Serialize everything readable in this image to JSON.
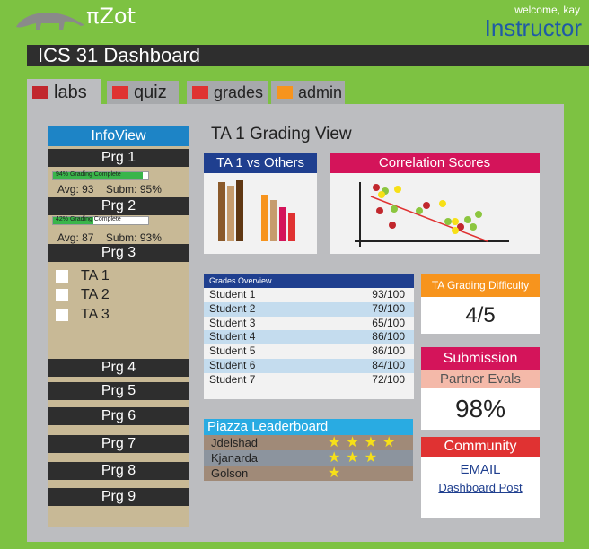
{
  "header": {
    "brand": "πZot",
    "welcome": "welcome, kay",
    "role": "Instructor",
    "title": "ICS 31 Dashboard"
  },
  "tabs": [
    {
      "label": "labs",
      "color": "#c1272d"
    },
    {
      "label": "quiz",
      "color": "#e03232"
    },
    {
      "label": "grades",
      "color": "#e03232"
    },
    {
      "label": "admin",
      "color": "#f7941d"
    }
  ],
  "sidebar": {
    "header": "InfoView",
    "programs": [
      {
        "label": "Prg 1",
        "progress": 0.94,
        "progress_label": "94% Grading Complete",
        "avg": "Avg: 93",
        "subm": "Subm: 95%"
      },
      {
        "label": "Prg 2",
        "progress": 0.42,
        "progress_label": "42% Grading Complete",
        "avg": "Avg: 87",
        "subm": "Subm: 93%"
      },
      {
        "label": "Prg 3"
      },
      {
        "label": "Prg 4"
      },
      {
        "label": "Prg 5"
      },
      {
        "label": "Prg 6"
      },
      {
        "label": "Prg 7"
      },
      {
        "label": "Prg 8"
      },
      {
        "label": "Prg 9"
      }
    ],
    "tas": [
      "TA 1",
      "TA 2",
      "TA 3"
    ]
  },
  "main": {
    "title": "TA 1 Grading View",
    "vs_title": "TA 1 vs Others",
    "corr_title": "Correlation Scores",
    "grades": {
      "header": "Grades Overview",
      "rows": [
        {
          "name": "Student 1",
          "score": "93/100"
        },
        {
          "name": "Student 2",
          "score": "79/100"
        },
        {
          "name": "Student 3",
          "score": "65/100"
        },
        {
          "name": "Student 4",
          "score": "86/100"
        },
        {
          "name": "Student 5",
          "score": "86/100"
        },
        {
          "name": "Student 6",
          "score": "84/100"
        },
        {
          "name": "Student 7",
          "score": "72/100"
        }
      ]
    },
    "difficulty": {
      "title": "TA Grading Difficulty",
      "value": "4/5"
    },
    "submission": {
      "title": "Submission",
      "subtitle": "Partner Evals",
      "value": "98%"
    },
    "community": {
      "title": "Community",
      "links": [
        "EMAIL",
        "Dashboard Post"
      ]
    },
    "piazza": {
      "title": "Piazza Leaderboard",
      "rows": [
        {
          "name": "Jdelshad",
          "stars": 4
        },
        {
          "name": "Kjanarda",
          "stars": 3
        },
        {
          "name": "Golson",
          "stars": 1
        }
      ]
    }
  },
  "colors": {
    "bg": "#7dc242",
    "dark": "#2e2e2e",
    "blue": "#1d84c6",
    "navy": "#1f3f8f",
    "magenta": "#d4145a",
    "orange": "#f7941d"
  }
}
